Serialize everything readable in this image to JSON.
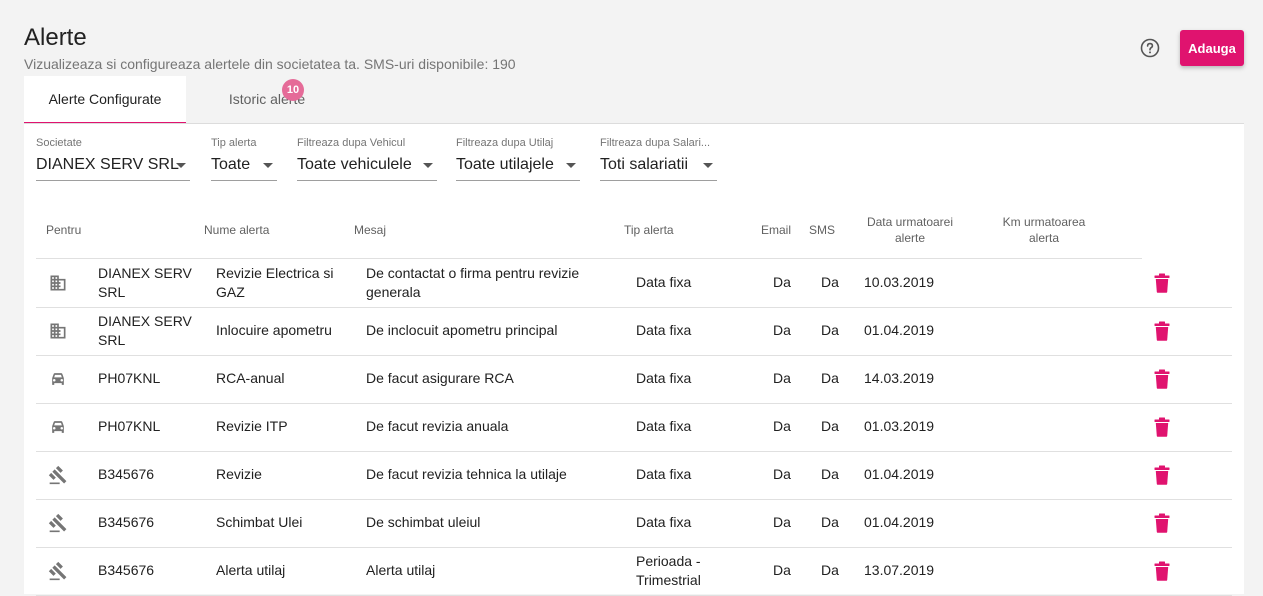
{
  "header": {
    "title": "Alerte",
    "subtitle": "Vizualizeaza si configureaza alertele din societatea ta. SMS-uri disponibile: 190",
    "add_label": "Adauga",
    "help_icon": "help-circle-icon"
  },
  "tabs": [
    {
      "label": "Alerte Configurate",
      "active": true
    },
    {
      "label": "Istoric alerte",
      "badge": "10"
    }
  ],
  "filters": [
    {
      "label": "Societate",
      "value": "DIANEX SERV SRL"
    },
    {
      "label": "Tip alerta",
      "value": "Toate"
    },
    {
      "label": "Filtreaza dupa Vehicul",
      "value": "Toate vehiculele"
    },
    {
      "label": "Filtreaza dupa Utilaj",
      "value": "Toate utilajele"
    },
    {
      "label": "Filtreaza dupa Salari...",
      "value": "Toti salariatii"
    }
  ],
  "table": {
    "headers": {
      "pentru": "Pentru",
      "nume": "Nume alerta",
      "mesaj": "Mesaj",
      "tip": "Tip alerta",
      "email": "Email",
      "sms": "SMS",
      "data_line1": "Data urmatoarei",
      "data_line2": "alerte",
      "km_line1": "Km urmatoarea",
      "km_line2": "alerta"
    },
    "rows": [
      {
        "icon": "building-icon",
        "pentru_1": "DIANEX SERV",
        "pentru_2": "SRL",
        "nume_1": "Revizie Electrica si",
        "nume_2": "GAZ",
        "mesaj_1": "De contactat o firma pentru revizie",
        "mesaj_2": "generala",
        "tip_1": "Data fixa",
        "tip_2": "",
        "email": "Da",
        "sms": "Da",
        "data": "10.03.2019",
        "km": ""
      },
      {
        "icon": "building-icon",
        "pentru_1": "DIANEX SERV",
        "pentru_2": "SRL",
        "nume_1": "Inlocuire apometru",
        "nume_2": "",
        "mesaj_1": "De inclocuit apometru principal",
        "mesaj_2": "",
        "tip_1": "Data fixa",
        "tip_2": "",
        "email": "Da",
        "sms": "Da",
        "data": "01.04.2019",
        "km": ""
      },
      {
        "icon": "car-icon",
        "pentru_1": "PH07KNL",
        "pentru_2": "",
        "nume_1": "RCA-anual",
        "nume_2": "",
        "mesaj_1": "De facut asigurare RCA",
        "mesaj_2": "",
        "tip_1": "Data fixa",
        "tip_2": "",
        "email": "Da",
        "sms": "Da",
        "data": "14.03.2019",
        "km": ""
      },
      {
        "icon": "car-icon",
        "pentru_1": "PH07KNL",
        "pentru_2": "",
        "nume_1": "Revizie ITP",
        "nume_2": "",
        "mesaj_1": "De facut revizia anuala",
        "mesaj_2": "",
        "tip_1": "Data fixa",
        "tip_2": "",
        "email": "Da",
        "sms": "Da",
        "data": "01.03.2019",
        "km": ""
      },
      {
        "icon": "gavel-icon",
        "pentru_1": "B345676",
        "pentru_2": "",
        "nume_1": "Revizie",
        "nume_2": "",
        "mesaj_1": "De facut revizia tehnica la utilaje",
        "mesaj_2": "",
        "tip_1": "Data fixa",
        "tip_2": "",
        "email": "Da",
        "sms": "Da",
        "data": "01.04.2019",
        "km": ""
      },
      {
        "icon": "gavel-icon",
        "pentru_1": "B345676",
        "pentru_2": "",
        "nume_1": "Schimbat Ulei",
        "nume_2": "",
        "mesaj_1": "De schimbat uleiul",
        "mesaj_2": "",
        "tip_1": "Data fixa",
        "tip_2": "",
        "email": "Da",
        "sms": "Da",
        "data": "01.04.2019",
        "km": ""
      },
      {
        "icon": "gavel-icon",
        "pentru_1": "B345676",
        "pentru_2": "",
        "nume_1": "Alerta utilaj",
        "nume_2": "",
        "mesaj_1": "Alerta utilaj",
        "mesaj_2": "",
        "tip_1": "Perioada -",
        "tip_2": "Trimestrial",
        "email": "Da",
        "sms": "Da",
        "data": "13.07.2019",
        "km": ""
      }
    ]
  },
  "colors": {
    "accent": "#e0136f",
    "badge": "#e56b98",
    "icon_gray": "#757575"
  }
}
